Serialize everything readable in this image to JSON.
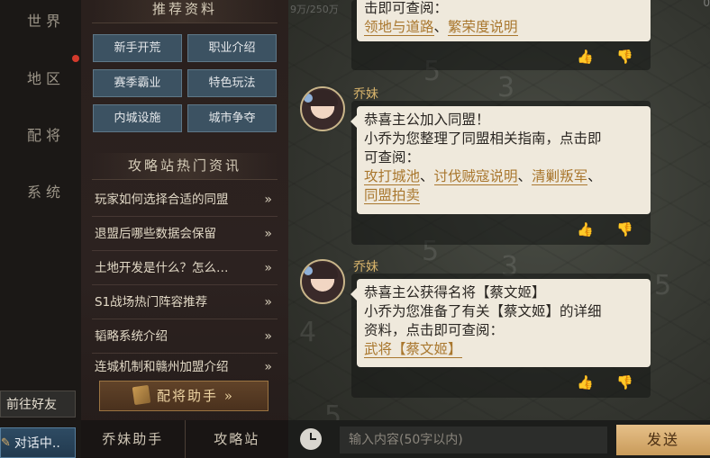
{
  "left_nav": {
    "items": [
      {
        "label": "世界"
      },
      {
        "label": "地区"
      },
      {
        "label": "配将"
      },
      {
        "label": "系统"
      }
    ],
    "friend_button": "前往好友",
    "chat_button": "对话中.."
  },
  "map": {
    "resource_text": "9万/250万",
    "corner_text": "0",
    "digits": [
      "5",
      "3",
      "5",
      "4",
      "5",
      "3",
      "5"
    ]
  },
  "guide": {
    "recommended_title": "推荐资料",
    "recommended": [
      {
        "label": "新手开荒"
      },
      {
        "label": "职业介绍"
      },
      {
        "label": "赛季霸业"
      },
      {
        "label": "特色玩法"
      },
      {
        "label": "内城设施"
      },
      {
        "label": "城市争夺"
      }
    ],
    "news_title": "攻略站热门资讯",
    "news": [
      {
        "label": "玩家如何选择合适的同盟",
        "arrow": "»"
      },
      {
        "label": "退盟后哪些数据会保留",
        "arrow": "»"
      },
      {
        "label": "土地开发是什么？怎么…",
        "arrow": "»"
      },
      {
        "label": "S1战场热门阵容推荐",
        "arrow": "»"
      },
      {
        "label": "韬略系统介绍",
        "arrow": "»"
      },
      {
        "label": "连城机制和赣州加盟介绍",
        "arrow": "»"
      }
    ],
    "helper_button": "配将助手 »",
    "tabs": [
      {
        "label": "乔妹助手"
      },
      {
        "label": "攻略站"
      }
    ]
  },
  "chat": {
    "messages": [
      {
        "sender": "",
        "lines": [
          "击即可查阅："
        ],
        "links": [
          "领地与道路",
          "繁荣度说明"
        ],
        "sep": "、"
      },
      {
        "sender": "乔妹",
        "lines": [
          "恭喜主公加入同盟！",
          "小乔为您整理了同盟相关指南，点击即",
          "可查阅："
        ],
        "links": [
          "攻打城池",
          "讨伐贼寇说明",
          "清剿叛军",
          "同盟拍卖"
        ],
        "sep": "、"
      },
      {
        "sender": "乔妹",
        "lines": [
          "恭喜主公获得名将【蔡文姬】",
          "小乔为您准备了有关【蔡文姬】的详细",
          "资料，点击即可查阅："
        ],
        "links": [
          "武将【蔡文姬】"
        ],
        "sep": "、"
      }
    ],
    "input_placeholder": "输入内容(50字以内)",
    "send_label": "发送",
    "icons": {
      "like": "thumbs-up-icon",
      "dislike": "thumbs-down-icon",
      "history": "clock-icon"
    }
  }
}
